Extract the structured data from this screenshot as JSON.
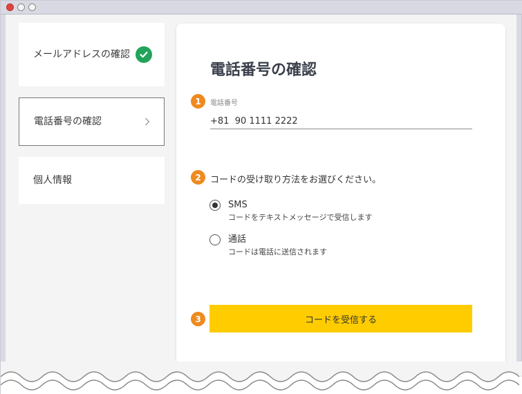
{
  "sidebar": {
    "items": [
      {
        "label": "メールアドレスの確認",
        "state": "completed",
        "icon": "check-circle-icon"
      },
      {
        "label": "電話番号の確認",
        "state": "current",
        "icon": "chevron-right-icon"
      },
      {
        "label": "個人情報",
        "state": "pending"
      }
    ]
  },
  "main": {
    "title": "電話番号の確認",
    "steps": [
      "1",
      "2",
      "3"
    ],
    "phone": {
      "label": "電話番号",
      "value": "+81  90 1111 2222"
    },
    "method": {
      "question": "コードの受け取り方法をお選びください。",
      "options": [
        {
          "name": "SMS",
          "desc": "コードをテキストメッセージで受信します",
          "selected": true
        },
        {
          "name": "通話",
          "desc": "コードは電話に送信されます",
          "selected": false
        }
      ]
    },
    "submit_label": "コードを受信する"
  },
  "colors": {
    "accent_yellow": "#ffcc00",
    "step_orange": "#ef8a1f",
    "success_green": "#21a45a",
    "window_frame": "#d9d9e3"
  }
}
